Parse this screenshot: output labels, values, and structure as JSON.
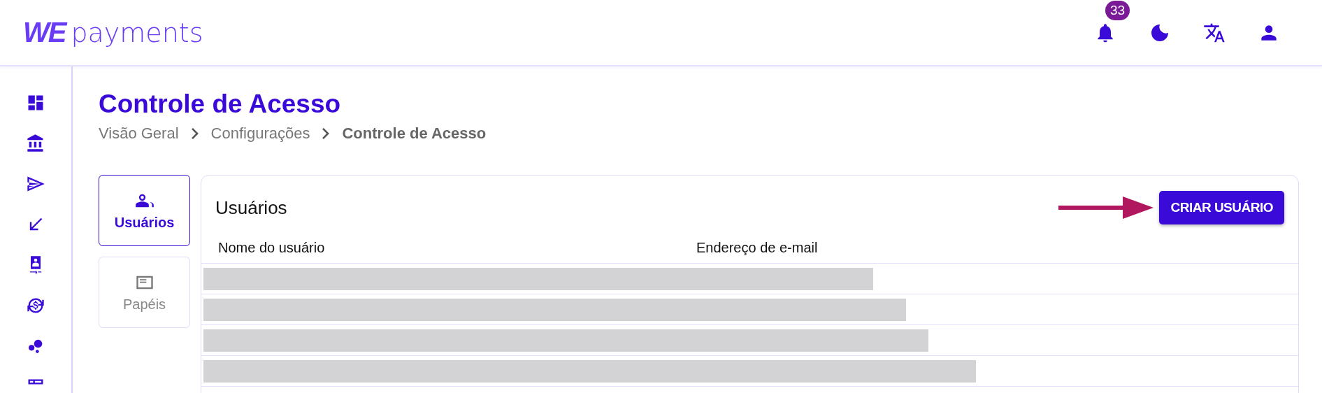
{
  "header": {
    "logo_mark": "WE",
    "logo_text": "payments",
    "notification_count": "33"
  },
  "sidebar": {
    "items": [
      {
        "kind": "dashboard"
      },
      {
        "kind": "bank"
      },
      {
        "kind": "send"
      },
      {
        "kind": "receive"
      },
      {
        "kind": "device"
      },
      {
        "kind": "exchange"
      },
      {
        "kind": "bubbles"
      },
      {
        "kind": "grid"
      }
    ]
  },
  "page": {
    "title": "Controle de Acesso",
    "breadcrumb": [
      {
        "label": "Visão Geral",
        "current": false
      },
      {
        "label": "Configurações",
        "current": false
      },
      {
        "label": "Controle de Acesso",
        "current": true
      }
    ]
  },
  "tabs": [
    {
      "label": "Usuários",
      "kind": "users",
      "selected": true
    },
    {
      "label": "Papéis",
      "kind": "roles",
      "selected": false
    }
  ],
  "panel": {
    "title": "Usuários",
    "button": "CRIAR USUÁRIO",
    "table": {
      "columns": [
        "Nome do usuário",
        "Endereço de e-mail"
      ],
      "rows": [
        {
          "kind": "redacted"
        },
        {
          "kind": "redacted"
        },
        {
          "kind": "redacted"
        },
        {
          "kind": "redacted"
        }
      ]
    }
  }
}
